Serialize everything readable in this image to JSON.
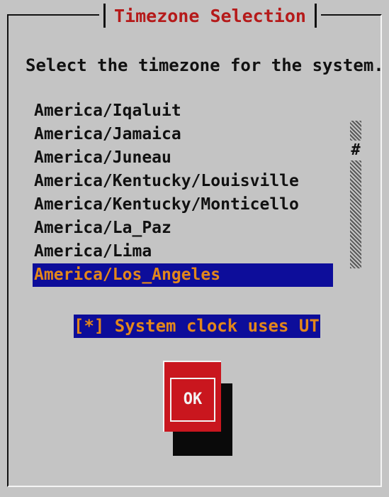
{
  "dialog": {
    "title": "Timezone Selection",
    "prompt": "Select the timezone for the system."
  },
  "timezones": {
    "items": [
      "America/Iqaluit",
      "America/Jamaica",
      "America/Juneau",
      "America/Kentucky/Louisville",
      "America/Kentucky/Monticello",
      "America/La_Paz",
      "America/Lima",
      "America/Los_Angeles"
    ],
    "selected": "America/Los_Angeles",
    "scroll_thumb": "#"
  },
  "utc_option": {
    "label": "[*] System clock uses UTC",
    "checked": true
  },
  "buttons": {
    "ok": "OK"
  },
  "colors": {
    "background": "#c4c4c4",
    "title": "#b51a1a",
    "selection_bg": "#0d0d9a",
    "selection_fg": "#e2871b",
    "button": "#c9161e"
  }
}
